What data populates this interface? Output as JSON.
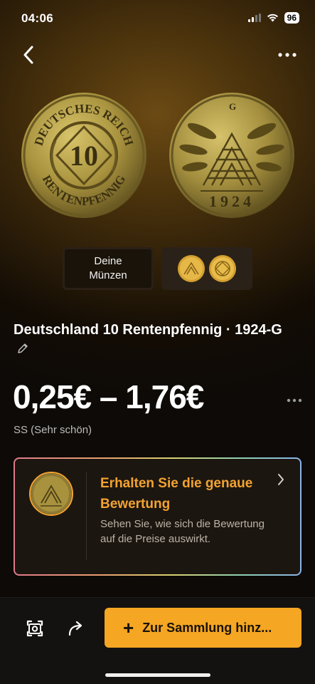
{
  "status_bar": {
    "time": "04:06",
    "battery": "96"
  },
  "coins": {
    "obverse_top_text": "DEUTSCHES REICH",
    "obverse_value": "10",
    "obverse_bottom_text": "RENTENPFENNIG",
    "reverse_mint_mark": "G",
    "reverse_year": "1924"
  },
  "switcher": {
    "deine_line1": "Deine",
    "deine_line2": "Münzen"
  },
  "title": "Deutschland 10 Rentenpfennig · 1924-G",
  "price_range": "0,25€ – 1,76€",
  "grade": "SS (Sehr schön)",
  "valuation_card": {
    "heading": "Erhalten Sie die genaue Bewertung",
    "subtext": "Sehen Sie, wie sich die Bewertung auf die Preise auswirkt."
  },
  "bottom_bar": {
    "add_label": "Zur Sammlung hinz..."
  },
  "colors": {
    "accent": "#f5a623",
    "coin_gold": "#b8a248",
    "background": "#0d0a07"
  },
  "icons": [
    "back-icon",
    "more-icon",
    "edit-icon",
    "chevron-right-icon",
    "scan-icon",
    "share-icon",
    "plus-icon"
  ]
}
